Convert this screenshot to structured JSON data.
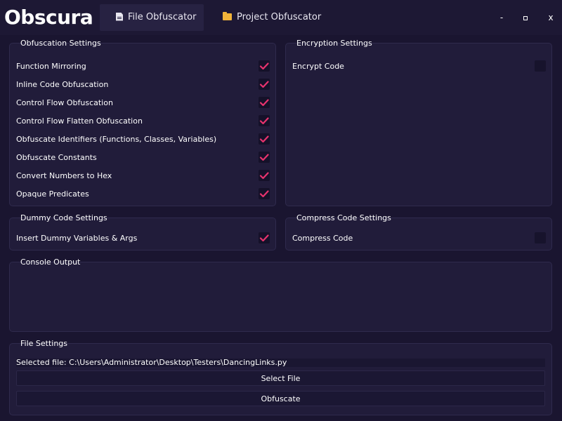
{
  "app": {
    "title": "Obscura"
  },
  "tabs": [
    {
      "label": "File Obfuscator",
      "icon": "file-icon",
      "active": true
    },
    {
      "label": "Project Obfuscator",
      "icon": "folder-icon",
      "active": false
    }
  ],
  "window_controls": {
    "minimize": "-",
    "close": "x"
  },
  "colors": {
    "accent": "#e8336e",
    "background": "#1a1530",
    "panel": "#211c3a",
    "folder": "#f2b43a"
  },
  "obfuscation": {
    "title": "Obfuscation Settings",
    "options": [
      {
        "label": "Function Mirroring",
        "checked": true
      },
      {
        "label": "Inline Code Obfuscation",
        "checked": true
      },
      {
        "label": "Control Flow Obfuscation",
        "checked": true
      },
      {
        "label": "Control Flow Flatten Obfuscation",
        "checked": true
      },
      {
        "label": "Obfuscate Identifiers (Functions, Classes, Variables)",
        "checked": true
      },
      {
        "label": "Obfuscate Constants",
        "checked": true
      },
      {
        "label": "Convert Numbers to Hex",
        "checked": true
      },
      {
        "label": "Opaque Predicates",
        "checked": true
      }
    ]
  },
  "encryption": {
    "title": "Encryption Settings",
    "options": [
      {
        "label": "Encrypt Code",
        "checked": false
      }
    ]
  },
  "dummy": {
    "title": "Dummy Code Settings",
    "options": [
      {
        "label": "Insert Dummy Variables & Args",
        "checked": true
      }
    ]
  },
  "compress": {
    "title": "Compress Code Settings",
    "options": [
      {
        "label": "Compress Code",
        "checked": false
      }
    ]
  },
  "console": {
    "title": "Console Output",
    "text": ""
  },
  "file_settings": {
    "title": "File Settings",
    "selected_file": "Selected file: C:\\Users\\Administrator\\Desktop\\Testers\\DancingLinks.py",
    "select_button": "Select File",
    "obfuscate_button": "Obfuscate"
  }
}
